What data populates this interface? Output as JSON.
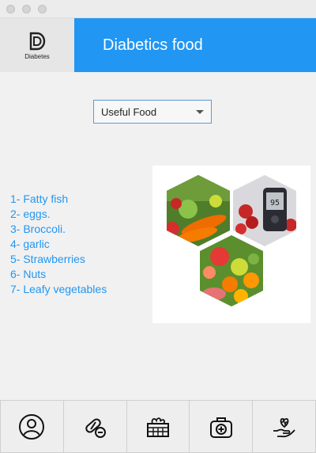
{
  "app": {
    "logo_text": "Diabetes",
    "title": "Diabetics food"
  },
  "category_select": {
    "selected": "Useful Food"
  },
  "food_list": [
    "1- Fatty fish",
    "2- eggs.",
    "3- Broccoli.",
    "4- garlic",
    "5- Strawberries",
    "6- Nuts",
    "7- Leafy vegetables"
  ],
  "food_image": {
    "icon": "hexagon-food-collage"
  },
  "bottom_nav": [
    {
      "icon": "user-icon"
    },
    {
      "icon": "pills-icon"
    },
    {
      "icon": "vegetable-basket-icon"
    },
    {
      "icon": "medical-kit-icon"
    },
    {
      "icon": "heart-hand-care-icon"
    }
  ],
  "colors": {
    "accent": "#2196f3",
    "list_text": "#2196f3",
    "background": "#f1f1f1"
  }
}
